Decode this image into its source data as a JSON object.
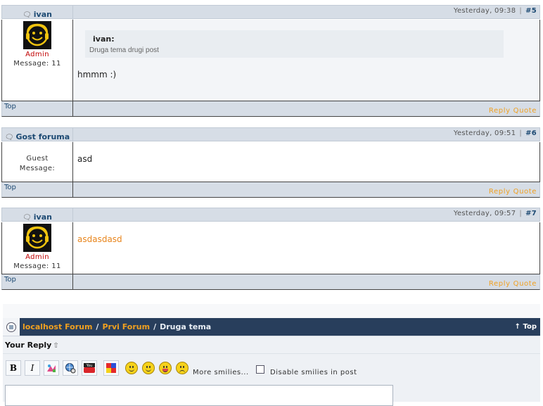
{
  "posts": [
    {
      "author": "ivan",
      "date": "Yesterday, 09:38",
      "number": "#5",
      "role": "Admin",
      "message_count": "Message: 11",
      "quote": {
        "author": "ivan:",
        "text": "Druga tema drugi post"
      },
      "body": "hmmm :)",
      "top_label": "Top",
      "reply_label": "Reply",
      "quote_label": "Quote"
    },
    {
      "author": "Gost foruma",
      "date": "Yesterday, 09:51",
      "number": "#6",
      "role": "Guest",
      "message_count": "Message:",
      "body": "asd",
      "top_label": "Top",
      "reply_label": "Reply",
      "quote_label": "Quote"
    },
    {
      "author": "ivan",
      "date": "Yesterday, 09:57",
      "number": "#7",
      "role": "Admin",
      "message_count": "Message: 11",
      "body": "asdasdasd",
      "top_label": "Top",
      "reply_label": "Reply",
      "quote_label": "Quote"
    }
  ],
  "nav": {
    "forum": "localhost Forum",
    "subforum": "Prvi Forum",
    "topic": "Druga tema",
    "separator": "/",
    "top_label": "↑ Top"
  },
  "reply_box": {
    "title": "Your Reply",
    "bold": "B",
    "italic": "I",
    "more_smilies": "More smilies...",
    "disable_smilies": "Disable smilies in post"
  },
  "colors": {
    "header_bg": "#d6dde6",
    "nav_bg": "#283e5c",
    "accent_orange": "#f0a020",
    "admin_red": "#c00000",
    "link_blue": "#1d4a73"
  }
}
